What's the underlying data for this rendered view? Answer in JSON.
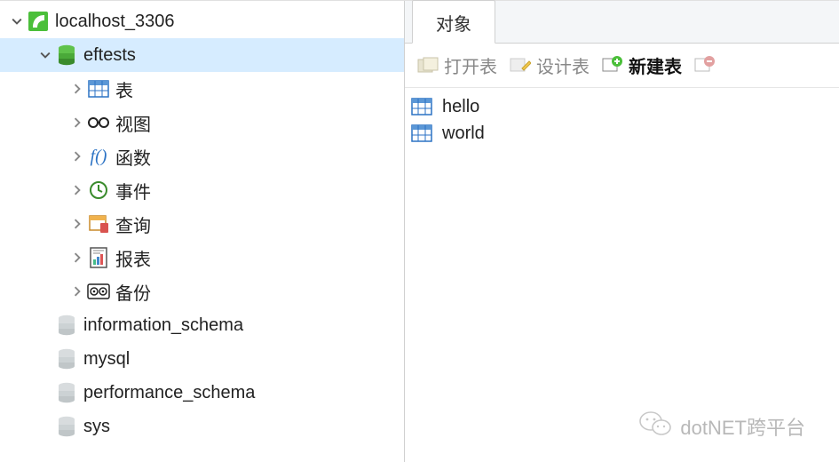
{
  "tree": {
    "connection": "localhost_3306",
    "selected_db": "eftests",
    "items": [
      {
        "label": "表"
      },
      {
        "label": "视图"
      },
      {
        "label": "函数"
      },
      {
        "label": "事件"
      },
      {
        "label": "查询"
      },
      {
        "label": "报表"
      },
      {
        "label": "备份"
      }
    ],
    "other_dbs": [
      "information_schema",
      "mysql",
      "performance_schema",
      "sys"
    ]
  },
  "tabs": {
    "active": "对象"
  },
  "toolbar": {
    "open": "打开表",
    "design": "设计表",
    "new": "新建表"
  },
  "tables": [
    "hello",
    "world"
  ],
  "watermark": "dotNET跨平台"
}
